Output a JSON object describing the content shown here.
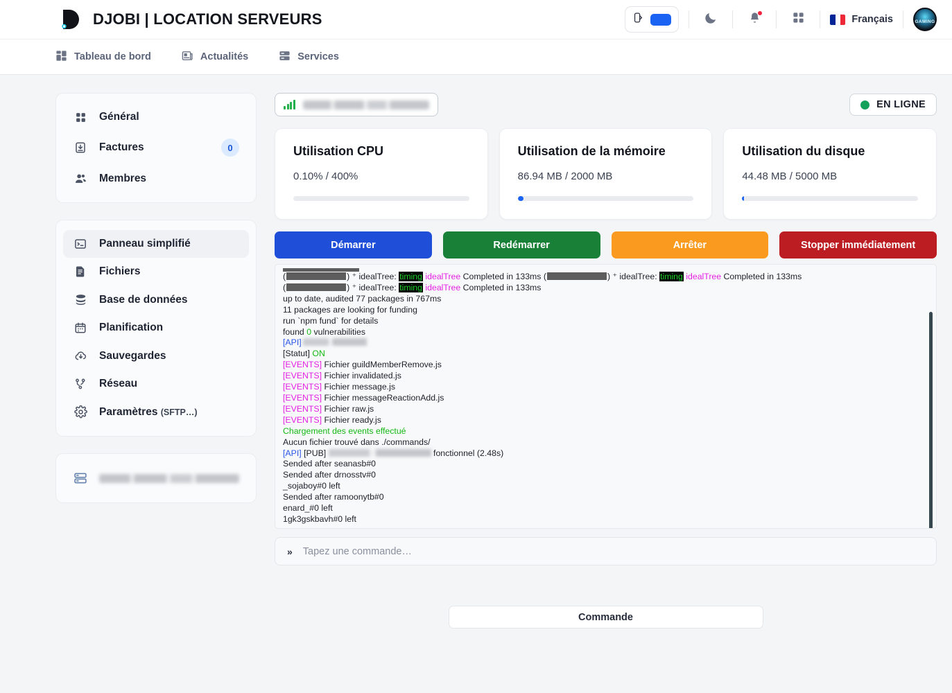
{
  "header": {
    "brand_title": "DJOBI | LOCATION SERVEURS",
    "logo_icon": "djobi-d-logo",
    "theme_toggle_icon": "palette-icon",
    "theme_swatch_color": "#1a63f3",
    "dark_mode_icon": "moon-icon",
    "notifications_icon": "bell-icon",
    "apps_icon": "grid-apps-icon",
    "language_label": "Français",
    "language_flag_icon": "france-flag-icon",
    "avatar_icon": "user-avatar",
    "avatar_text": "GAMING"
  },
  "nav": {
    "items": [
      {
        "label": "Tableau de bord",
        "icon": "dashboard-grid-icon"
      },
      {
        "label": "Actualités",
        "icon": "news-icon"
      },
      {
        "label": "Services",
        "icon": "server-rack-icon"
      }
    ]
  },
  "sidebar": {
    "group1": [
      {
        "label": "Général",
        "icon": "grid-icon",
        "badge": null
      },
      {
        "label": "Factures",
        "icon": "invoice-download-icon",
        "badge": "0"
      },
      {
        "label": "Membres",
        "icon": "members-icon",
        "badge": null
      }
    ],
    "group2": [
      {
        "label": "Panneau simplifié",
        "icon": "terminal-icon",
        "active": true,
        "sub": ""
      },
      {
        "label": "Fichiers",
        "icon": "file-icon",
        "active": false,
        "sub": ""
      },
      {
        "label": "Base de données",
        "icon": "database-icon",
        "active": false,
        "sub": ""
      },
      {
        "label": "Planification",
        "icon": "calendar-icon",
        "active": false,
        "sub": ""
      },
      {
        "label": "Sauvegardes",
        "icon": "cloud-download-icon",
        "active": false,
        "sub": ""
      },
      {
        "label": "Réseau",
        "icon": "network-share-icon",
        "active": false,
        "sub": ""
      },
      {
        "label": "Paramètres",
        "icon": "gear-icon",
        "active": false,
        "sub": "(SFTP…)"
      }
    ],
    "server_entry": {
      "icon": "server-icon",
      "label_redacted": true
    }
  },
  "main": {
    "server_selector": {
      "icon": "signal-bars-icon",
      "value_redacted": true
    },
    "status": {
      "label": "EN LIGNE",
      "dot_color": "#12a05a"
    },
    "stats": [
      {
        "title": "Utilisation CPU",
        "value": "0.10% / 400%",
        "percent": 0.025,
        "bar_color": "#1a63f3"
      },
      {
        "title": "Utilisation de la mémoire",
        "value": "86.94 MB / 2000 MB",
        "percent": 4.3,
        "bar_color": "#1a63f3"
      },
      {
        "title": "Utilisation du disque",
        "value": "44.48 MB / 5000 MB",
        "percent": 0.9,
        "bar_color": "#1a63f3"
      }
    ],
    "actions": [
      {
        "label": "Démarrer",
        "color": "#1f4fd8"
      },
      {
        "label": "Redémarrer",
        "color": "#198038"
      },
      {
        "label": "Arrêter",
        "color": "#fa9a1e"
      },
      {
        "label": "Stopper immédiatement",
        "color": "#bb1d22"
      }
    ],
    "console": {
      "lines": [
        {
          "id": "l1",
          "text": "up to date, audited 77 packages in 767ms"
        },
        {
          "id": "l2",
          "text": "11 packages are looking for funding"
        },
        {
          "id": "l3",
          "text": "run `npm fund` for details"
        },
        {
          "id": "l4a",
          "text": "found "
        },
        {
          "id": "l4b",
          "text": "0"
        },
        {
          "id": "l4c",
          "text": " vulnerabilities"
        },
        {
          "id": "l5",
          "text": "[API]"
        },
        {
          "id": "l6a",
          "text": "[Statut] "
        },
        {
          "id": "l6b",
          "text": "ON"
        },
        {
          "id": "e1t",
          "text": "[EVENTS]"
        },
        {
          "id": "e1",
          "text": " Fichier guildMemberRemove.js"
        },
        {
          "id": "e2",
          "text": " Fichier invalidated.js"
        },
        {
          "id": "e3",
          "text": " Fichier message.js"
        },
        {
          "id": "e4",
          "text": " Fichier messageReactionAdd.js"
        },
        {
          "id": "e5",
          "text": " Fichier raw.js"
        },
        {
          "id": "e6",
          "text": " Fichier ready.js"
        },
        {
          "id": "l7",
          "text": "Chargement des events effectué"
        },
        {
          "id": "l8",
          "text": "Aucun fichier trouvé dans ./commands/"
        },
        {
          "id": "l9a",
          "text": "[API]"
        },
        {
          "id": "l9b",
          "text": " [PUB] "
        },
        {
          "id": "l9c",
          "text": " fonctionnel (2.48s)"
        },
        {
          "id": "l10",
          "text": "Sended after seanasb#0"
        },
        {
          "id": "l11",
          "text": "Sended after drnosstv#0"
        },
        {
          "id": "l12",
          "text": "_sojaboy#0 left"
        },
        {
          "id": "l13",
          "text": "Sended after ramoonytb#0"
        },
        {
          "id": "l14",
          "text": "enard_#0 left"
        },
        {
          "id": "l15",
          "text": "1gk3gskbavh#0 left"
        }
      ],
      "npm_line": {
        "open_paren": "(",
        "close_paren": ") ",
        "ideal_tree_prefix": "⁺ idealTree: ",
        "timing_tag": "timing",
        "ideal_tree_name": "idealTree",
        "completed": " Completed in 133ms"
      }
    },
    "command_input": {
      "prefix_icon": "double-chevron-right-icon",
      "placeholder": "Tapez une commande…",
      "value": ""
    },
    "command_button": {
      "label": "Commande"
    }
  }
}
